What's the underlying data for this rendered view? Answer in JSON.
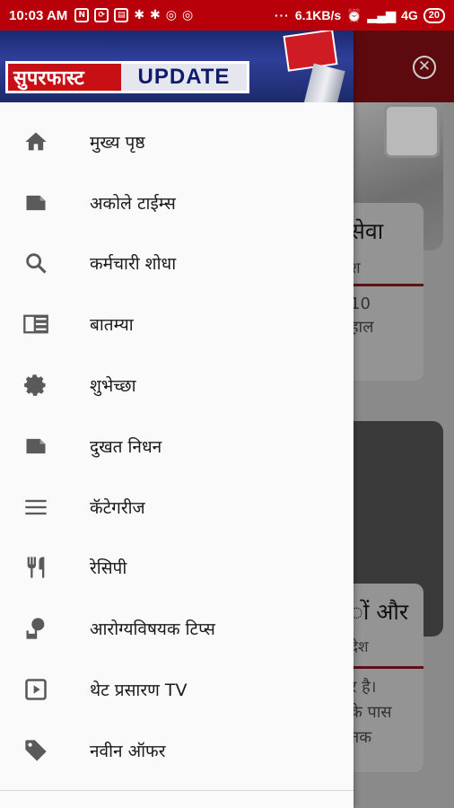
{
  "status_bar": {
    "time": "10:03 AM",
    "speed": "6.1KB/s",
    "network": "4G",
    "battery": "20",
    "overflow": "···"
  },
  "banner": {
    "hindi_text": "सुपरफास्ट",
    "english_text": "UPDATE"
  },
  "menu": [
    {
      "label": "मुख्य पृष्ठ",
      "icon": "home-icon"
    },
    {
      "label": "अकोले टाईम्स",
      "icon": "note-icon"
    },
    {
      "label": "कर्मचारी शोधा",
      "icon": "search-icon"
    },
    {
      "label": "बातम्या",
      "icon": "newspaper-icon"
    },
    {
      "label": "शुभेच्छा",
      "icon": "gear-icon"
    },
    {
      "label": "दुखत निधन",
      "icon": "note-icon"
    },
    {
      "label": "कॅटेगरीज",
      "icon": "menu-lines-icon"
    },
    {
      "label": "रेसिपी",
      "icon": "restaurant-icon"
    },
    {
      "label": "आरोग्यविषयक टिप्स",
      "icon": "health-icon"
    },
    {
      "label": "थेट प्रसारण TV",
      "icon": "play-icon"
    },
    {
      "label": "नवीन ऑफर",
      "icon": "tag-icon"
    }
  ],
  "background": {
    "card1_title": "सेवा",
    "card1_sub": "श",
    "card1_text1": "10",
    "card1_text2": "हाल",
    "card2_title": "ों और",
    "card2_sub": "देश",
    "card2_text1": "र है।",
    "card2_text2": "के पास",
    "card2_text3": "तक"
  },
  "colors": {
    "status_bar": "#b8000a",
    "drawer_bg": "#fafafa",
    "icon": "#5a5a5a"
  }
}
